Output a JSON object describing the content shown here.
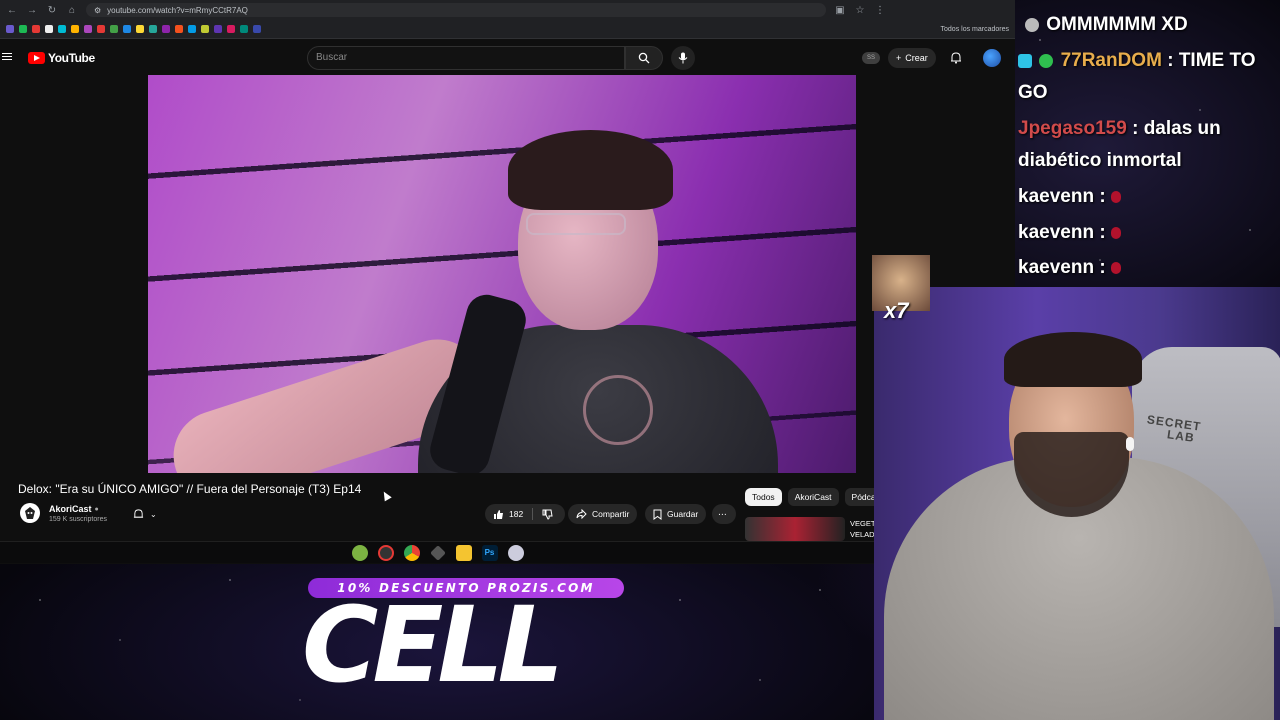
{
  "browser": {
    "url": "youtube.com/watch?v=mRmyCCtR7AQ",
    "bookmarks_all": "Todos los marcadores"
  },
  "youtube": {
    "logo_text": "YouTube",
    "search_placeholder": "Buscar",
    "create_label": "Crear",
    "ss_badge": "SS"
  },
  "video": {
    "title": "Delox: \"Era su ÚNICO AMIGO\" // Fuera del Personaje (T3) Ep14",
    "channel_name": "AkoriCast",
    "subscribers": "159 K suscriptores",
    "likes": "182",
    "share_label": "Compartir",
    "save_label": "Guardar"
  },
  "sidebar_chips": [
    "Todos",
    "AkoriCast",
    "Pódca"
  ],
  "recommendation": {
    "title_line1": "VEGET",
    "title_line2": "VELAD"
  },
  "promo": {
    "discount": "10% DESCUENTO PROZIS.COM",
    "code": "CELL"
  },
  "chat": {
    "line_top": "OMMMMMM XD",
    "messages": [
      {
        "user": "77RanDOM",
        "sep": " : ",
        "text": "TIME TO"
      },
      {
        "user": "",
        "sep": "",
        "text": "GO"
      },
      {
        "user": "Jpegaso159",
        "sep": " : ",
        "text": "dalas un"
      },
      {
        "user": "",
        "sep": "",
        "text": "diabético inmortal"
      },
      {
        "user": "kaevenn",
        "sep": " : ",
        "text": ""
      },
      {
        "user": "kaevenn",
        "sep": " : ",
        "text": ""
      },
      {
        "user": "kaevenn",
        "sep": " : ",
        "text": ""
      }
    ],
    "emote_multiplier": "x7"
  },
  "webcam": {
    "chair_brand_line1": "SECRET",
    "chair_brand_line2": "LAB"
  },
  "colors": {
    "youtube_red": "#ff0000",
    "chat_user_gold": "#e8ad4c",
    "chat_user_red": "#d14b4b",
    "promo_purple": "#a43be0"
  }
}
